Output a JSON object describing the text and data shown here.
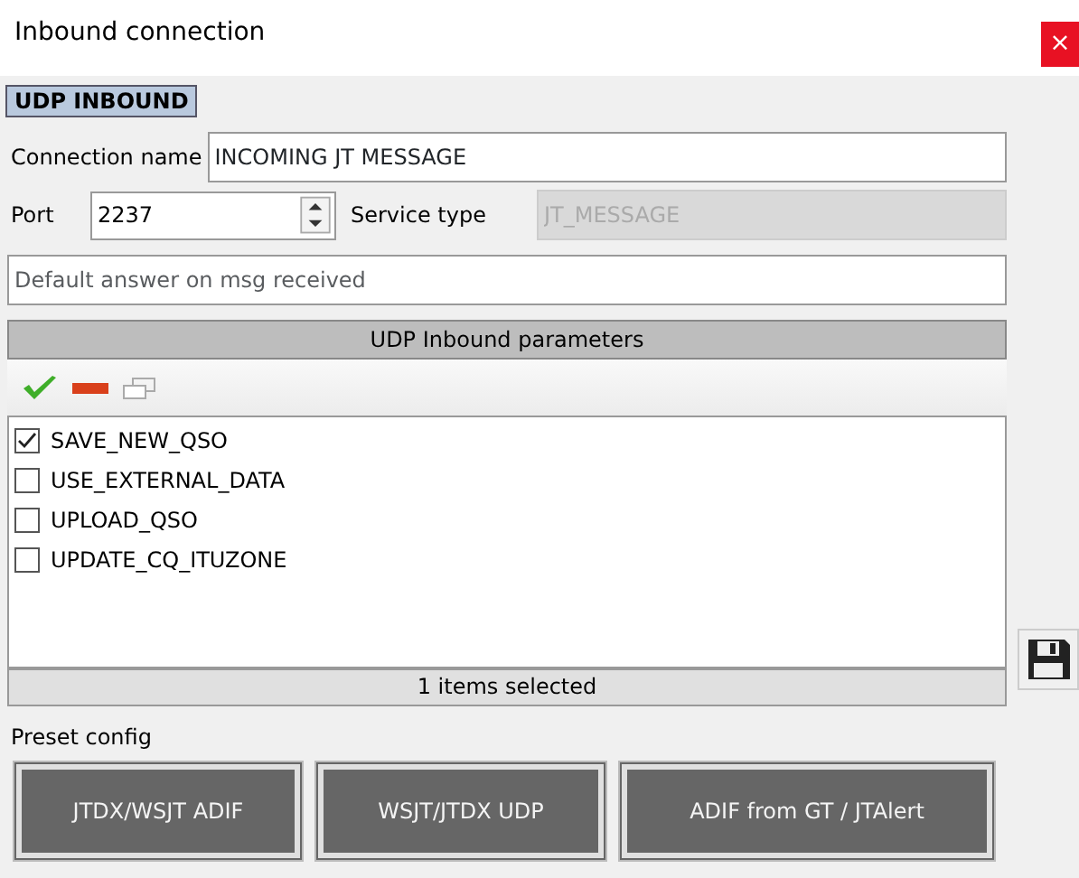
{
  "window": {
    "title": "Inbound connection",
    "close": "×"
  },
  "section_label": "UDP INBOUND",
  "connection_name": {
    "label": "Connection name",
    "value": "INCOMING JT MESSAGE"
  },
  "port": {
    "label": "Port",
    "value": "2237"
  },
  "service_type": {
    "label": "Service type",
    "value": "JT_MESSAGE",
    "disabled": true
  },
  "default_answer": {
    "placeholder": "Default answer on msg received"
  },
  "parameters": {
    "header": "UDP Inbound parameters",
    "items": [
      {
        "label": "SAVE_NEW_QSO",
        "checked": true
      },
      {
        "label": "USE_EXTERNAL_DATA",
        "checked": false
      },
      {
        "label": "UPLOAD_QSO",
        "checked": false
      },
      {
        "label": "UPDATE_CQ_ITUZONE",
        "checked": false
      }
    ],
    "status": "1 items selected"
  },
  "preset": {
    "label": "Preset config",
    "buttons": [
      "JTDX/WSJT ADIF",
      "WSJT/JTDX UDP",
      "ADIF from GT / JTAlert"
    ]
  }
}
